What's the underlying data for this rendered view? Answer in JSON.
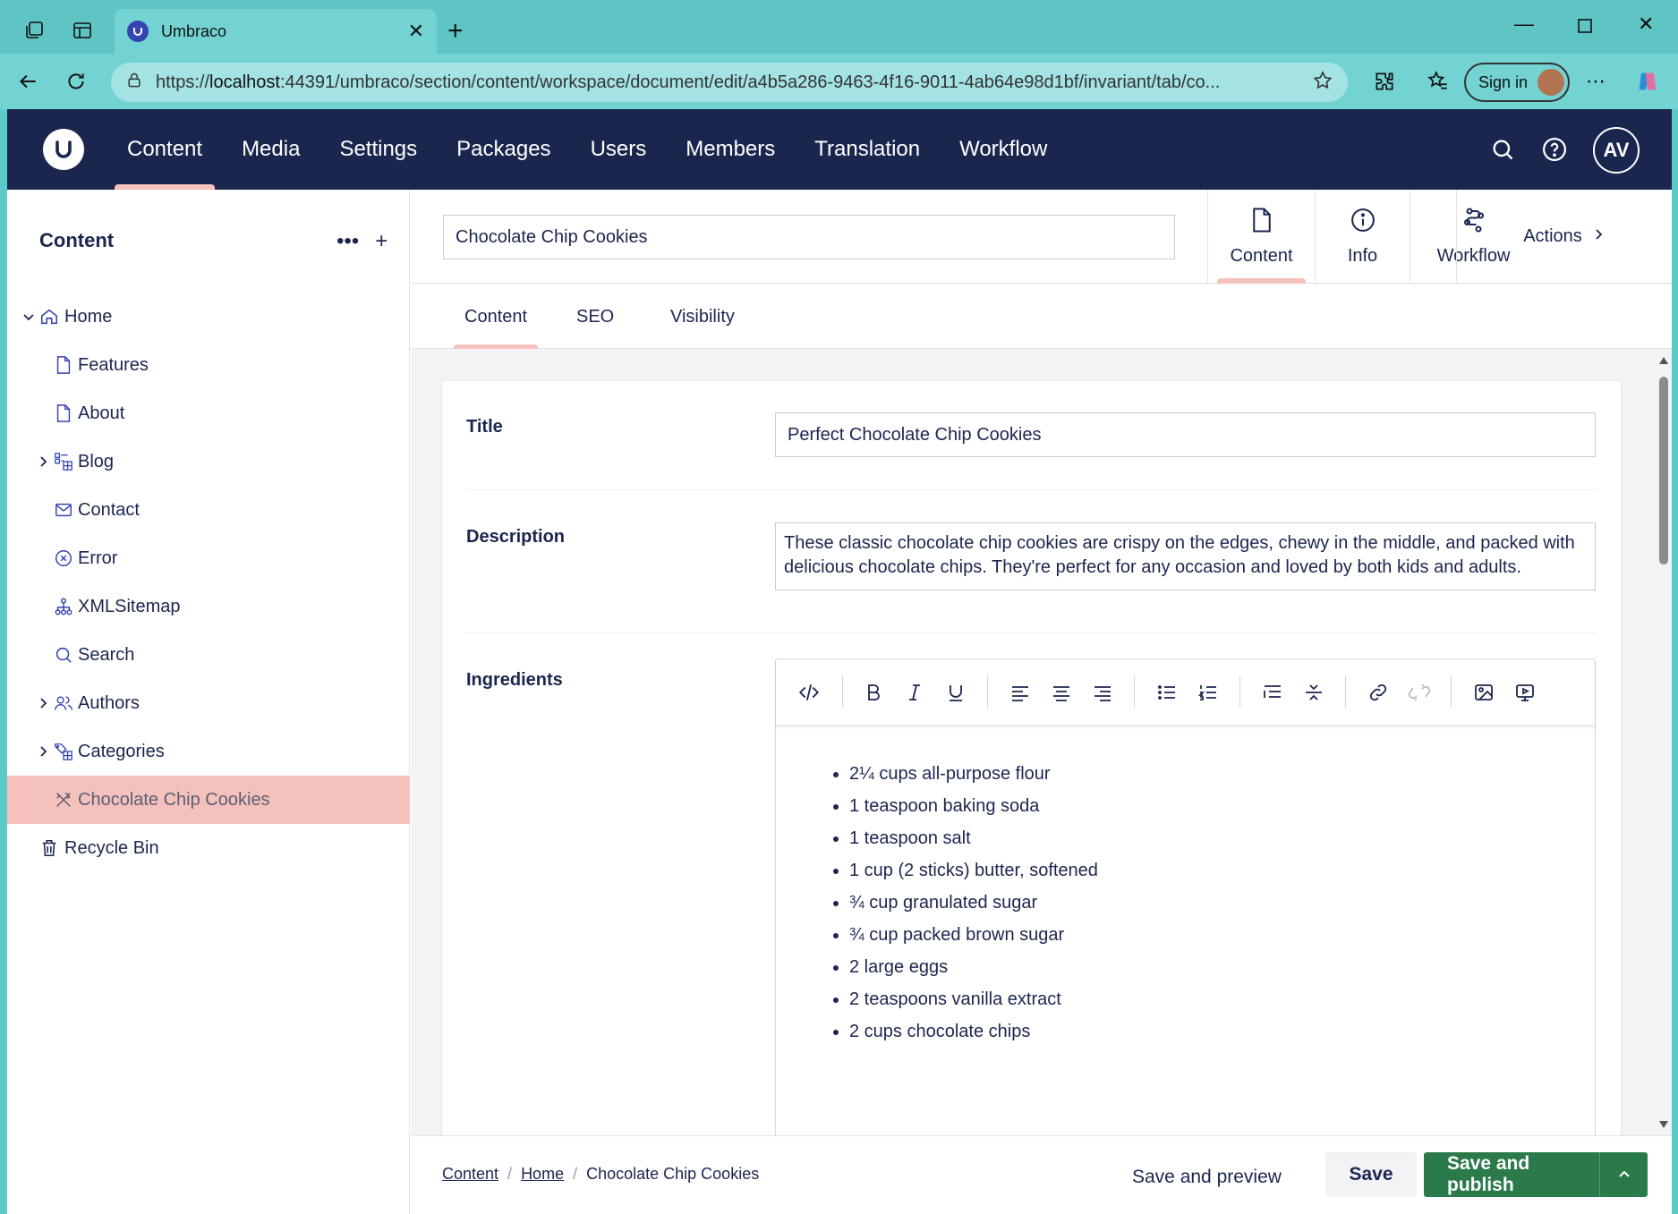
{
  "browser": {
    "tab_title": "Umbraco",
    "url_prefix": "https://",
    "url_host": "localhost",
    "url_rest": ":44391/umbraco/section/content/workspace/document/edit/a4b5a286-9463-4f16-9011-4ab64e98d1bf/invariant/tab/co...",
    "signin_label": "Sign in"
  },
  "header": {
    "nav": [
      "Content",
      "Media",
      "Settings",
      "Packages",
      "Users",
      "Members",
      "Translation",
      "Workflow"
    ],
    "active_nav": "Content",
    "avatar_initials": "AV"
  },
  "sidebar": {
    "title": "Content",
    "items": [
      {
        "label": "Home",
        "icon": "home-icon",
        "expandable": true,
        "expanded": true
      },
      {
        "label": "Features",
        "icon": "document-icon"
      },
      {
        "label": "About",
        "icon": "document-icon"
      },
      {
        "label": "Blog",
        "icon": "list-grid-icon",
        "expandable": true
      },
      {
        "label": "Contact",
        "icon": "mail-icon"
      },
      {
        "label": "Error",
        "icon": "error-circle-icon"
      },
      {
        "label": "XMLSitemap",
        "icon": "sitemap-icon"
      },
      {
        "label": "Search",
        "icon": "search-icon"
      },
      {
        "label": "Authors",
        "icon": "users-icon",
        "expandable": true
      },
      {
        "label": "Categories",
        "icon": "tags-grid-icon",
        "expandable": true
      },
      {
        "label": "Chocolate Chip Cookies",
        "icon": "utensils-icon",
        "selected": true
      },
      {
        "label": "Recycle Bin",
        "icon": "trash-icon"
      }
    ]
  },
  "workspace": {
    "document_name": "Chocolate Chip Cookies",
    "views": [
      "Content",
      "Info",
      "Workflow"
    ],
    "actions_label": "Actions",
    "tabs": [
      "Content",
      "SEO",
      "Visibility"
    ],
    "properties": {
      "title_label": "Title",
      "title_value": "Perfect Chocolate Chip Cookies",
      "description_label": "Description",
      "description_value": "These classic chocolate chip cookies are crispy on the edges, chewy in the middle, and packed with delicious chocolate chips. They're perfect for any occasion and loved by both kids and adults.",
      "ingredients_label": "Ingredients",
      "ingredients": [
        "2¼ cups all-purpose flour",
        "1 teaspoon baking soda",
        "1 teaspoon salt",
        "1 cup (2 sticks) butter, softened",
        "¾ cup granulated sugar",
        "¾ cup packed brown sugar",
        "2 large eggs",
        "2 teaspoons vanilla extract",
        "2 cups chocolate chips"
      ]
    }
  },
  "footer": {
    "breadcrumb": [
      "Content",
      "Home",
      "Chocolate Chip Cookies"
    ],
    "save_preview_label": "Save and preview",
    "save_label": "Save",
    "publish_label": "Save and publish"
  },
  "colors": {
    "header_bg": "#1b264f",
    "active_accent": "#f5c1bc",
    "publish_green": "#2b7a4b"
  }
}
